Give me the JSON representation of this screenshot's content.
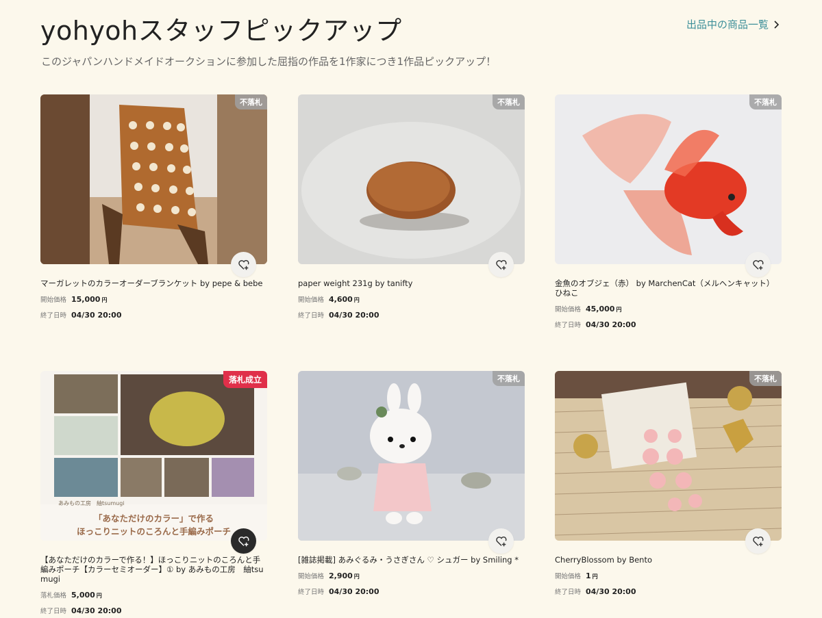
{
  "header": {
    "title": "yohyohスタッフピックアップ",
    "see_all": "出品中の商品一覧",
    "subtitle": "このジャパンハンドメイドオークションに参加した屈指の作品を1作家につき1作品ピックアップ！"
  },
  "labels": {
    "start_price": "開始価格",
    "sold_price": "落札価格",
    "end_date": "終了日時",
    "yen": "円"
  },
  "items": [
    {
      "badge": "不落札",
      "name": "マーガレットのカラーオーダーブランケット by pepe & bebe",
      "price_label": "開始価格",
      "price": "15,000",
      "end": "04/30 20:00"
    },
    {
      "badge": "不落札",
      "name": "paper weight 231g by tanifty",
      "price_label": "開始価格",
      "price": "4,600",
      "end": "04/30 20:00"
    },
    {
      "badge": "不落札",
      "name": "金魚のオブジェ（赤） by MarchenCat（メルヘンキャット）ひねこ",
      "price_label": "開始価格",
      "price": "45,000",
      "end": "04/30 20:00"
    },
    {
      "badge": "落札成立",
      "name": "【あなただけのカラーで作る！】ほっこりニットのころんと手編みポーチ【カラーセミオーダー】① by あみもの工房　紬tsumugi",
      "price_label": "落札価格",
      "price": "5,000",
      "end": "04/30 20:00"
    },
    {
      "badge": "不落札",
      "name": "[雑誌掲載] あみぐるみ・うさぎさん ♡ シュガー by Smiling *",
      "price_label": "開始価格",
      "price": "2,900",
      "end": "04/30 20:00"
    },
    {
      "badge": "不落札",
      "name": "CherryBlossom by Bento",
      "price_label": "開始価格",
      "price": "1",
      "end": "04/30 20:00"
    }
  ],
  "thumb4_text": {
    "brand": "あみもの工房　紬tsumugi",
    "line1": "「あなただけのカラー」で作る",
    "line2": "ほっこりニットのころんと手編みポーチ"
  },
  "icons": {
    "fav": "heart-plus-icon",
    "chevron": "chevron-right-icon"
  },
  "colors": {
    "link": "#3d8f99",
    "sold_badge": "#e0304a",
    "background": "#fcf8ec"
  }
}
